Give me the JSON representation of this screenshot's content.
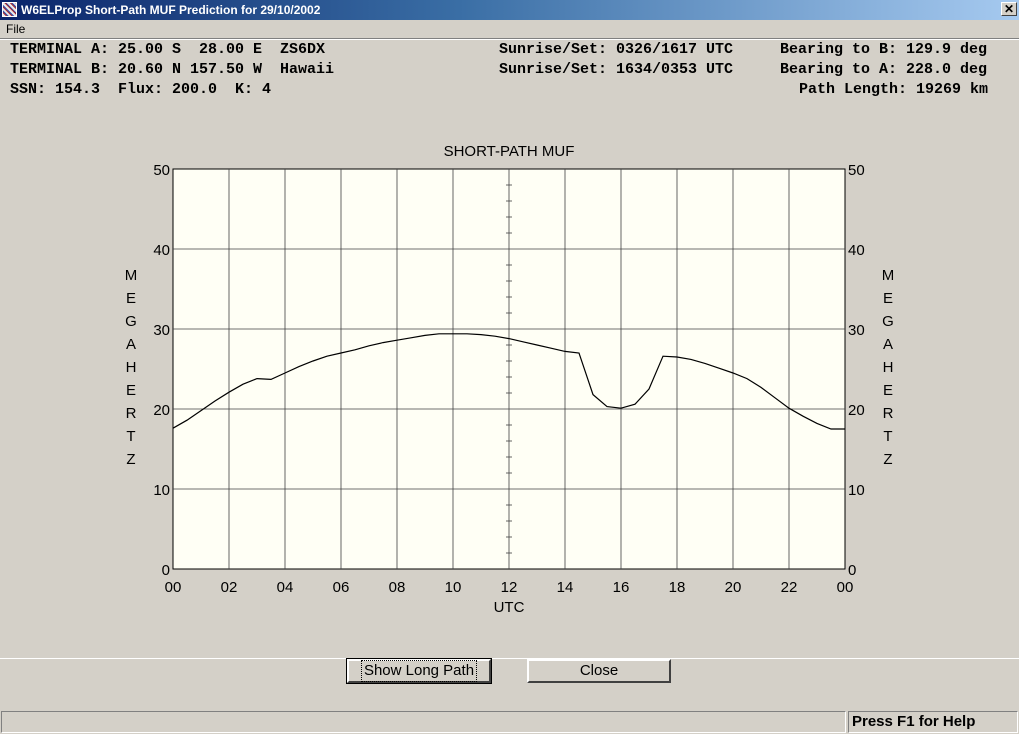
{
  "window": {
    "title": "W6ELProp Short-Path MUF Prediction for 29/10/2002",
    "close_glyph": "✕"
  },
  "menu": {
    "file": "File"
  },
  "info": {
    "line_a": "TERMINAL A: 25.00 S  28.00 E  ZS6DX",
    "line_b": "TERMINAL B: 20.60 N 157.50 W  Hawaii",
    "line_c": "SSN: 154.3  Flux: 200.0  K: 4",
    "sun_a": "Sunrise/Set: 0326/1617 UTC",
    "sun_b": "Sunrise/Set: 1634/0353 UTC",
    "bearing_b": "Bearing to B: 129.9 deg",
    "bearing_a": "Bearing to A: 228.0 deg",
    "path_length": "Path Length: 19269 km"
  },
  "buttons": {
    "long_path": "Show Long Path",
    "close": "Close"
  },
  "status": {
    "help": "Press F1 for Help"
  },
  "chart_data": {
    "type": "line",
    "title": "SHORT-PATH MUF",
    "xlabel": "UTC",
    "ylabel": "MEGAHERTZ",
    "ylabel_letters": [
      "M",
      "E",
      "G",
      "A",
      "H",
      "E",
      "R",
      "T",
      "Z"
    ],
    "xlim": [
      0,
      24
    ],
    "ylim": [
      0,
      50
    ],
    "x_ticks": [
      "00",
      "02",
      "04",
      "06",
      "08",
      "10",
      "12",
      "14",
      "16",
      "18",
      "20",
      "22",
      "00"
    ],
    "y_ticks": [
      "0",
      "10",
      "20",
      "30",
      "40",
      "50"
    ],
    "grid": true,
    "series": [
      {
        "x": [
          0,
          0.5,
          1,
          1.5,
          2,
          2.5,
          3,
          3.5,
          4,
          4.5,
          5,
          5.5,
          6,
          6.5,
          7,
          7.5,
          8,
          8.5,
          9,
          9.5,
          10,
          10.5,
          11,
          11.5,
          12,
          12.5,
          13,
          13.5,
          14,
          14.5,
          15,
          15.5,
          16,
          16.5,
          17,
          17.5,
          18,
          18.5,
          19,
          19.5,
          20,
          20.5,
          21,
          21.5,
          22,
          22.5,
          23,
          23.5,
          24
        ],
        "values": [
          17.6,
          18.6,
          19.8,
          21.0,
          22.1,
          23.1,
          23.8,
          23.7,
          24.5,
          25.3,
          26.0,
          26.6,
          27.0,
          27.4,
          27.9,
          28.3,
          28.6,
          28.9,
          29.2,
          29.4,
          29.4,
          29.4,
          29.3,
          29.1,
          28.8,
          28.4,
          28.0,
          27.6,
          27.2,
          27.0,
          21.8,
          20.3,
          20.1,
          20.6,
          22.5,
          26.6,
          26.5,
          26.2,
          25.7,
          25.1,
          24.5,
          23.8,
          22.7,
          21.4,
          20.1,
          19.1,
          18.2,
          17.5,
          17.5
        ]
      }
    ]
  }
}
